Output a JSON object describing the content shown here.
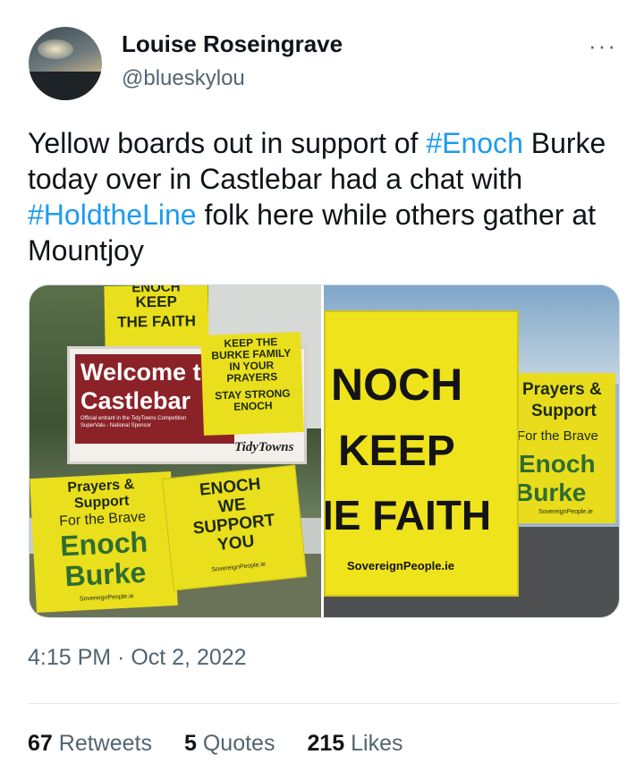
{
  "author": {
    "name": "Louise Roseingrave",
    "handle": "@blueskylou"
  },
  "tweet": {
    "text_1": "Yellow boards out in support of ",
    "tag_1": "#Enoch",
    "text_2": " Burke today over in Castlebar had a chat with ",
    "tag_2": "#HoldtheLine",
    "text_3": " folk here while others gather at Mountjoy"
  },
  "media": {
    "photo1": {
      "top_sign": [
        "ENOCH",
        "KEEP",
        "THE FAITH"
      ],
      "welcome_line1": "Welcome t",
      "welcome_line2": "Castlebar",
      "welcome_small1": "Official entrant in the TidyTowns Competition",
      "welcome_small2": "SuperValu - National Sponsor",
      "tidytowns": "TidyTowns",
      "family_sign": [
        "KEEP THE",
        "BURKE FAMILY",
        "IN YOUR",
        "PRAYERS",
        "STAY STRONG",
        "ENOCH"
      ],
      "prayers_sign": [
        "Prayers &",
        "Support",
        "For the Brave",
        "Enoch",
        "Burke",
        "SovereignPeople.ie"
      ],
      "support_sign": [
        "ENOCH",
        "WE",
        "SUPPORT",
        "YOU",
        "SovereignPeople.ie"
      ]
    },
    "photo2": {
      "big_sign": [
        "NOCH",
        "KEEP",
        "IE FAITH",
        "SovereignPeople.ie"
      ],
      "side_sign": [
        "Prayers &",
        "Support",
        "For the Brave",
        "Enoch",
        "Burke",
        "SovereignPeople.ie"
      ]
    }
  },
  "timestamp": "4:15 PM · Oct 2, 2022",
  "stats": {
    "retweets_count": "67",
    "retweets_label": "Retweets",
    "quotes_count": "5",
    "quotes_label": "Quotes",
    "likes_count": "215",
    "likes_label": "Likes"
  },
  "more_label": "···",
  "colors": {
    "link": "#1d9bf0",
    "secondary": "#536471",
    "sign_yellow": "#eadf1c"
  }
}
